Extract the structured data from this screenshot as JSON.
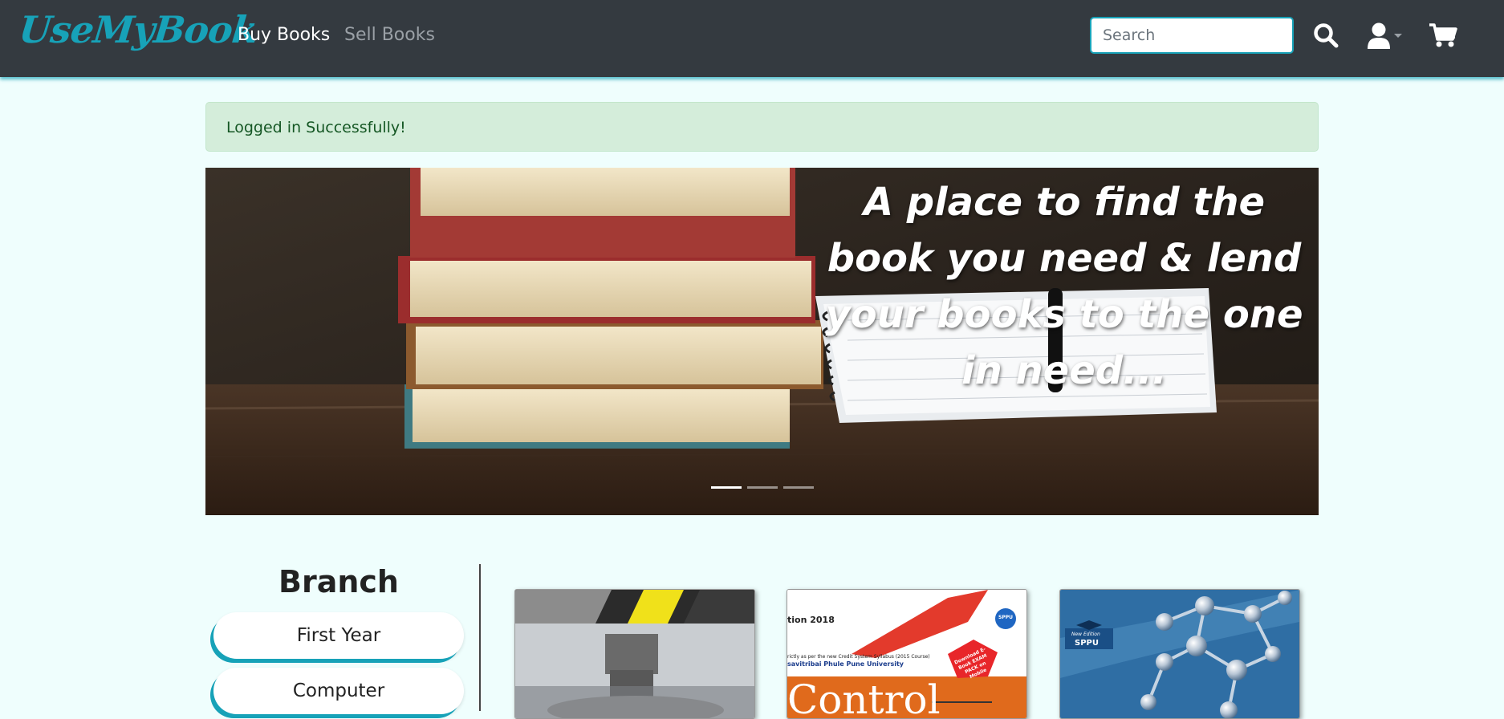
{
  "navbar": {
    "brand": "UseMyBook",
    "links": [
      {
        "label": "Buy Books",
        "active": true
      },
      {
        "label": "Sell Books",
        "active": false
      }
    ],
    "search_placeholder": "Search",
    "icons": [
      "search-icon",
      "user-icon",
      "caret-down-icon",
      "cart-icon"
    ]
  },
  "alert": {
    "message": "Logged in Successfully!"
  },
  "carousel": {
    "caption": "A place to find the book you need & lend your books to the one in need...",
    "indicator_count": 3,
    "active_indicator": 0
  },
  "branch": {
    "title": "Branch",
    "items": [
      {
        "label": "First Year"
      },
      {
        "label": "Computer"
      }
    ]
  },
  "books": [
    {
      "cover_text": ""
    },
    {
      "cover_banner": "tion 2018",
      "cover_line": "rictly as per the new Credit System Syllabus (2015 Course)",
      "cover_university": "savitribai Phule Pune University",
      "cover_title": "Control",
      "cover_badge": "SPPU",
      "cover_stamp": "Download E-Book EXAM PACK on Mobile"
    },
    {
      "cover_badge_top": "New Edition",
      "cover_badge": "SPPU"
    }
  ],
  "colors": {
    "accent": "#17a2b8",
    "navbar_bg": "#343a40",
    "page_bg": "#effefd",
    "alert_bg": "#d4edda",
    "alert_text": "#155724"
  }
}
